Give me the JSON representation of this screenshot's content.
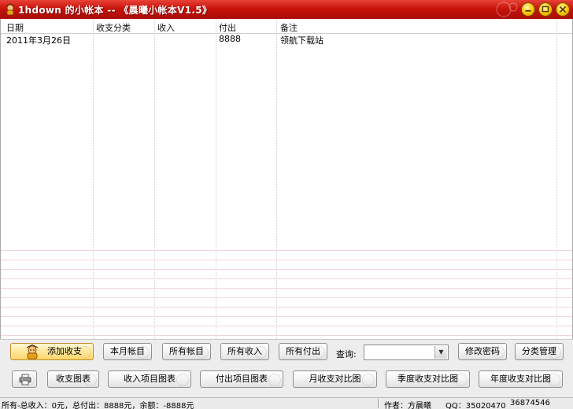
{
  "window": {
    "title": "1hdown 的小帐本 -- 《晨曦小帐本V1.5》"
  },
  "table": {
    "columns": [
      "日期",
      "收支分类",
      "收入",
      "付出",
      "备注"
    ],
    "rows": [
      {
        "date": "2011年3月26日",
        "category": "",
        "income": "",
        "expense": "8888",
        "note": "领航下载站"
      }
    ]
  },
  "toolbar": {
    "row1": {
      "add": "添加收支",
      "month_books": "本月帐目",
      "all_books": "所有帐目",
      "all_income": "所有收入",
      "all_expense": "所有付出",
      "query_label": "查询:",
      "query_value": "",
      "change_password": "修改密码",
      "category_manage": "分类管理"
    },
    "row2": {
      "chart": "收支图表",
      "income_chart": "收入项目图表",
      "expense_chart": "付出项目图表",
      "month_compare": "月收支对比图",
      "quarter_compare": "季度收支对比图",
      "year_compare": "年度收支对比图"
    }
  },
  "status": {
    "summary": "所有-总收入：0元，总付出：8888元，余额：-8888元",
    "author": "作者：方晨曦",
    "qq": "QQ：35020470",
    "qq2": "36874546"
  },
  "icons": {
    "app": "mascot-icon",
    "printer": "printer-icon",
    "add": "mascot-icon"
  },
  "colors": {
    "titlebar": "#c8140c",
    "control_buttons": "#f5c400",
    "grid_line": "#f1d6d6"
  }
}
